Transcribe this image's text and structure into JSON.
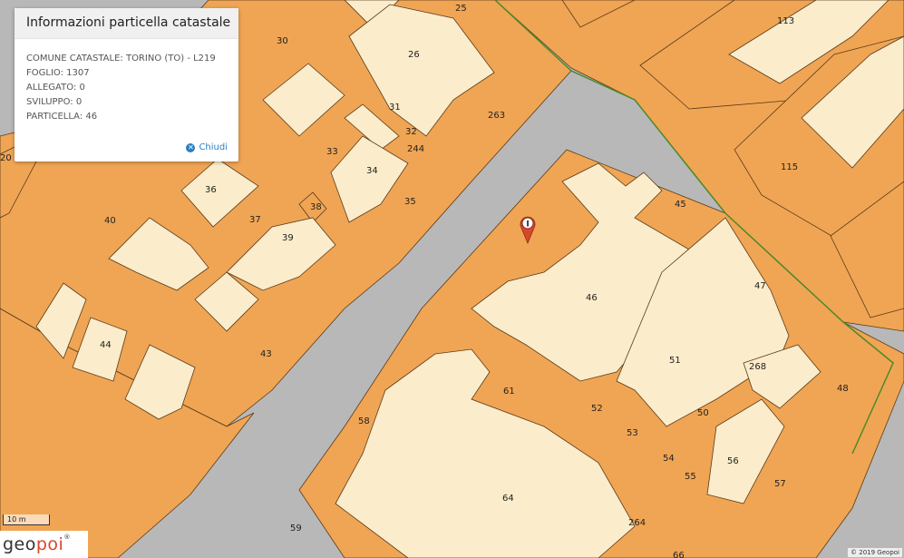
{
  "popup": {
    "title": "Informazioni particella catastale",
    "rows": [
      "COMUNE CATASTALE: TORINO (TO) - L219",
      "FOGLIO: 1307",
      "ALLEGATO: 0",
      "SVILUPPO: 0",
      "PARTICELLA: 46"
    ],
    "close_label": "Chiudi"
  },
  "map": {
    "colors": {
      "road": "#b8b8b8",
      "parcel": "#f0a554",
      "building": "#fbeccb",
      "line": "#5a3a1a",
      "boundary": "#4a8a2a"
    },
    "parcels": [
      "25",
      "26",
      "30",
      "31",
      "32",
      "33",
      "34",
      "35",
      "36",
      "37",
      "38",
      "39",
      "40",
      "43",
      "44",
      "45",
      "46",
      "47",
      "48",
      "50",
      "51",
      "52",
      "53",
      "54",
      "55",
      "56",
      "57",
      "58",
      "59",
      "61",
      "64",
      "66",
      "113",
      "115",
      "244",
      "263",
      "264",
      "268",
      "20"
    ]
  },
  "scalebar": {
    "label": "10 m"
  },
  "logo": {
    "text_a": "geo",
    "text_b": "poi",
    "mark": "®"
  },
  "attribution": {
    "text": "© 2019 Geopoi"
  },
  "marker": {
    "icon": "info-marker-icon",
    "letter": "I",
    "color": "#d9472b"
  }
}
